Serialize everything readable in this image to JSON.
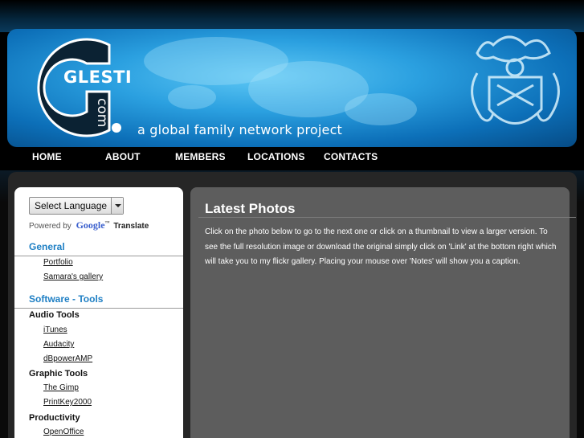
{
  "banner": {
    "logo_letters": "GLESTI",
    "logo_suffix": "com",
    "tagline": "a global family network project"
  },
  "nav": {
    "items": [
      {
        "label": "HOME"
      },
      {
        "label": "ABOUT"
      },
      {
        "label": "MEMBERS"
      },
      {
        "label": "LOCATIONS"
      },
      {
        "label": "CONTACTS"
      }
    ]
  },
  "sidebar": {
    "language_select": "Select Language",
    "powered_by": "Powered by",
    "google": "Google",
    "translate": "Translate",
    "general": {
      "title": "General",
      "links": [
        "Portfolio",
        "Samara's gallery"
      ]
    },
    "software": {
      "title": "Software - Tools",
      "groups": [
        {
          "title": "Audio Tools",
          "links": [
            "iTunes",
            "Audacity",
            "dBpowerAMP"
          ]
        },
        {
          "title": "Graphic Tools",
          "links": [
            "The Gimp",
            "PrintKey2000"
          ]
        },
        {
          "title": "Productivity",
          "links": [
            "OpenOffice"
          ]
        }
      ]
    }
  },
  "main": {
    "title": "Latest Photos",
    "body": "Click on the photo below to go to the next one or click on a thumbnail to view a larger version. To see the full resolution image or download the original simply click on 'Link' at the bottom right which will take you to my flickr gallery. Placing your mouse over 'Notes' will show you a caption."
  },
  "colors": {
    "section_title": "#1e7fc4",
    "main_panel": "#5d5d5d",
    "banner_blue": "#2ba0e0"
  }
}
